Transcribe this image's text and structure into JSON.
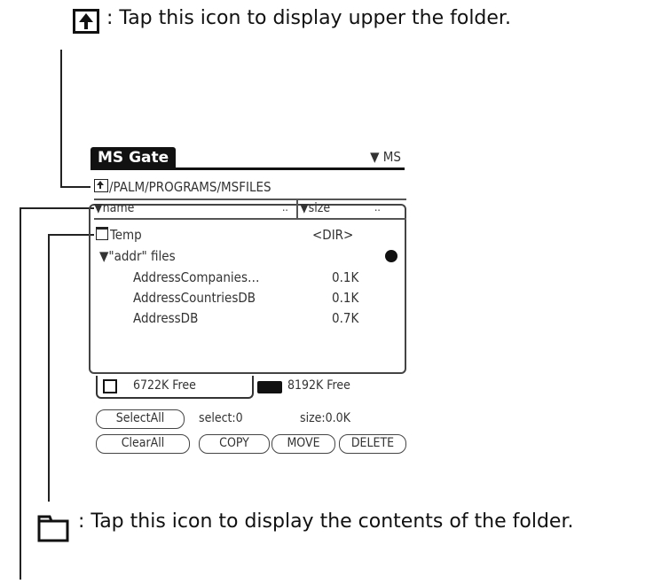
{
  "annotations": {
    "top_caption": ": Tap this icon to display upper the folder.",
    "bottom_caption": ": Tap this icon to display the contents of the folder."
  },
  "window": {
    "title": "MS Gate",
    "media_menu": "▼ MS",
    "path": "/PALM/PROGRAMS/MSFILES"
  },
  "columns": {
    "name": "▼name",
    "name_more": "..",
    "size": "▼size",
    "size_more": ".."
  },
  "rows": [
    {
      "name": "Temp",
      "size": "<DIR>"
    },
    {
      "name": "▼\"addr\" files",
      "size": ""
    },
    {
      "name": "AddressCompanies…",
      "size": "0.1K"
    },
    {
      "name": "AddressCountriesDB",
      "size": "0.1K"
    },
    {
      "name": "AddressDB",
      "size": "0.7K"
    }
  ],
  "storage": {
    "handheld_free": "6722K Free",
    "card_free": "8192K Free"
  },
  "buttons": {
    "select_all": "SelectAll",
    "clear_all": "ClearAll",
    "copy": "COPY",
    "move": "MOVE",
    "delete": "DELETE"
  },
  "status": {
    "select_count": "select:0",
    "size_total": "size:0.0K"
  },
  "icons": {
    "up_folder": "up-folder-icon",
    "open_folder": "folder-icon",
    "lock": "lock-icon"
  }
}
